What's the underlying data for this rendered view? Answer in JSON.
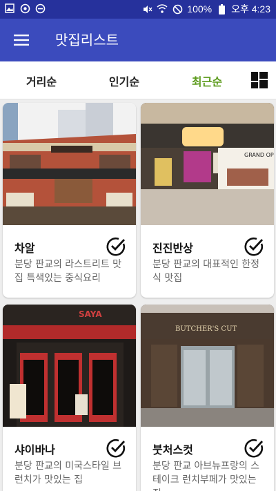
{
  "status_bar": {
    "icons_left": [
      "image-icon",
      "sync-icon",
      "minus-circle-icon"
    ],
    "icons_right": [
      "mute-icon",
      "wifi-icon",
      "no-signal-icon",
      "battery-icon"
    ],
    "battery": "100%",
    "time": "오후 4:23"
  },
  "app_bar": {
    "title": "맛집리스트",
    "menu_icon": "hamburger-menu-icon"
  },
  "tabs": {
    "items": [
      {
        "label": "거리순",
        "active": false
      },
      {
        "label": "인기순",
        "active": false
      },
      {
        "label": "최근순",
        "active": true
      }
    ],
    "toggle_icon": "grid-view-icon"
  },
  "colors": {
    "status_bar": "#26319c",
    "app_bar": "#3b4bbd",
    "active_tab": "#5a9a1a"
  },
  "restaurants": [
    {
      "name": "차알",
      "desc": "분당 판교의 라스트리트 맛집 특색있는 중식요리",
      "checked": true
    },
    {
      "name": "진진반상",
      "desc": "분당 판교의 대표적인 한정식 맛집",
      "checked": true
    },
    {
      "name": "샤이바나",
      "desc": "분당 판교의 미국스타일 브런치가 맛있는 집",
      "checked": true
    },
    {
      "name": "붓처스컷",
      "desc": "분당 판교 아브뉴프랑의 스테이크 런치부페가 맛있는 집",
      "checked": true
    }
  ],
  "signage": {
    "card2_banner": "GRAND OPEN",
    "card4_sign": "BUTCHER'S CUT",
    "card3_sign": "SAYA"
  }
}
